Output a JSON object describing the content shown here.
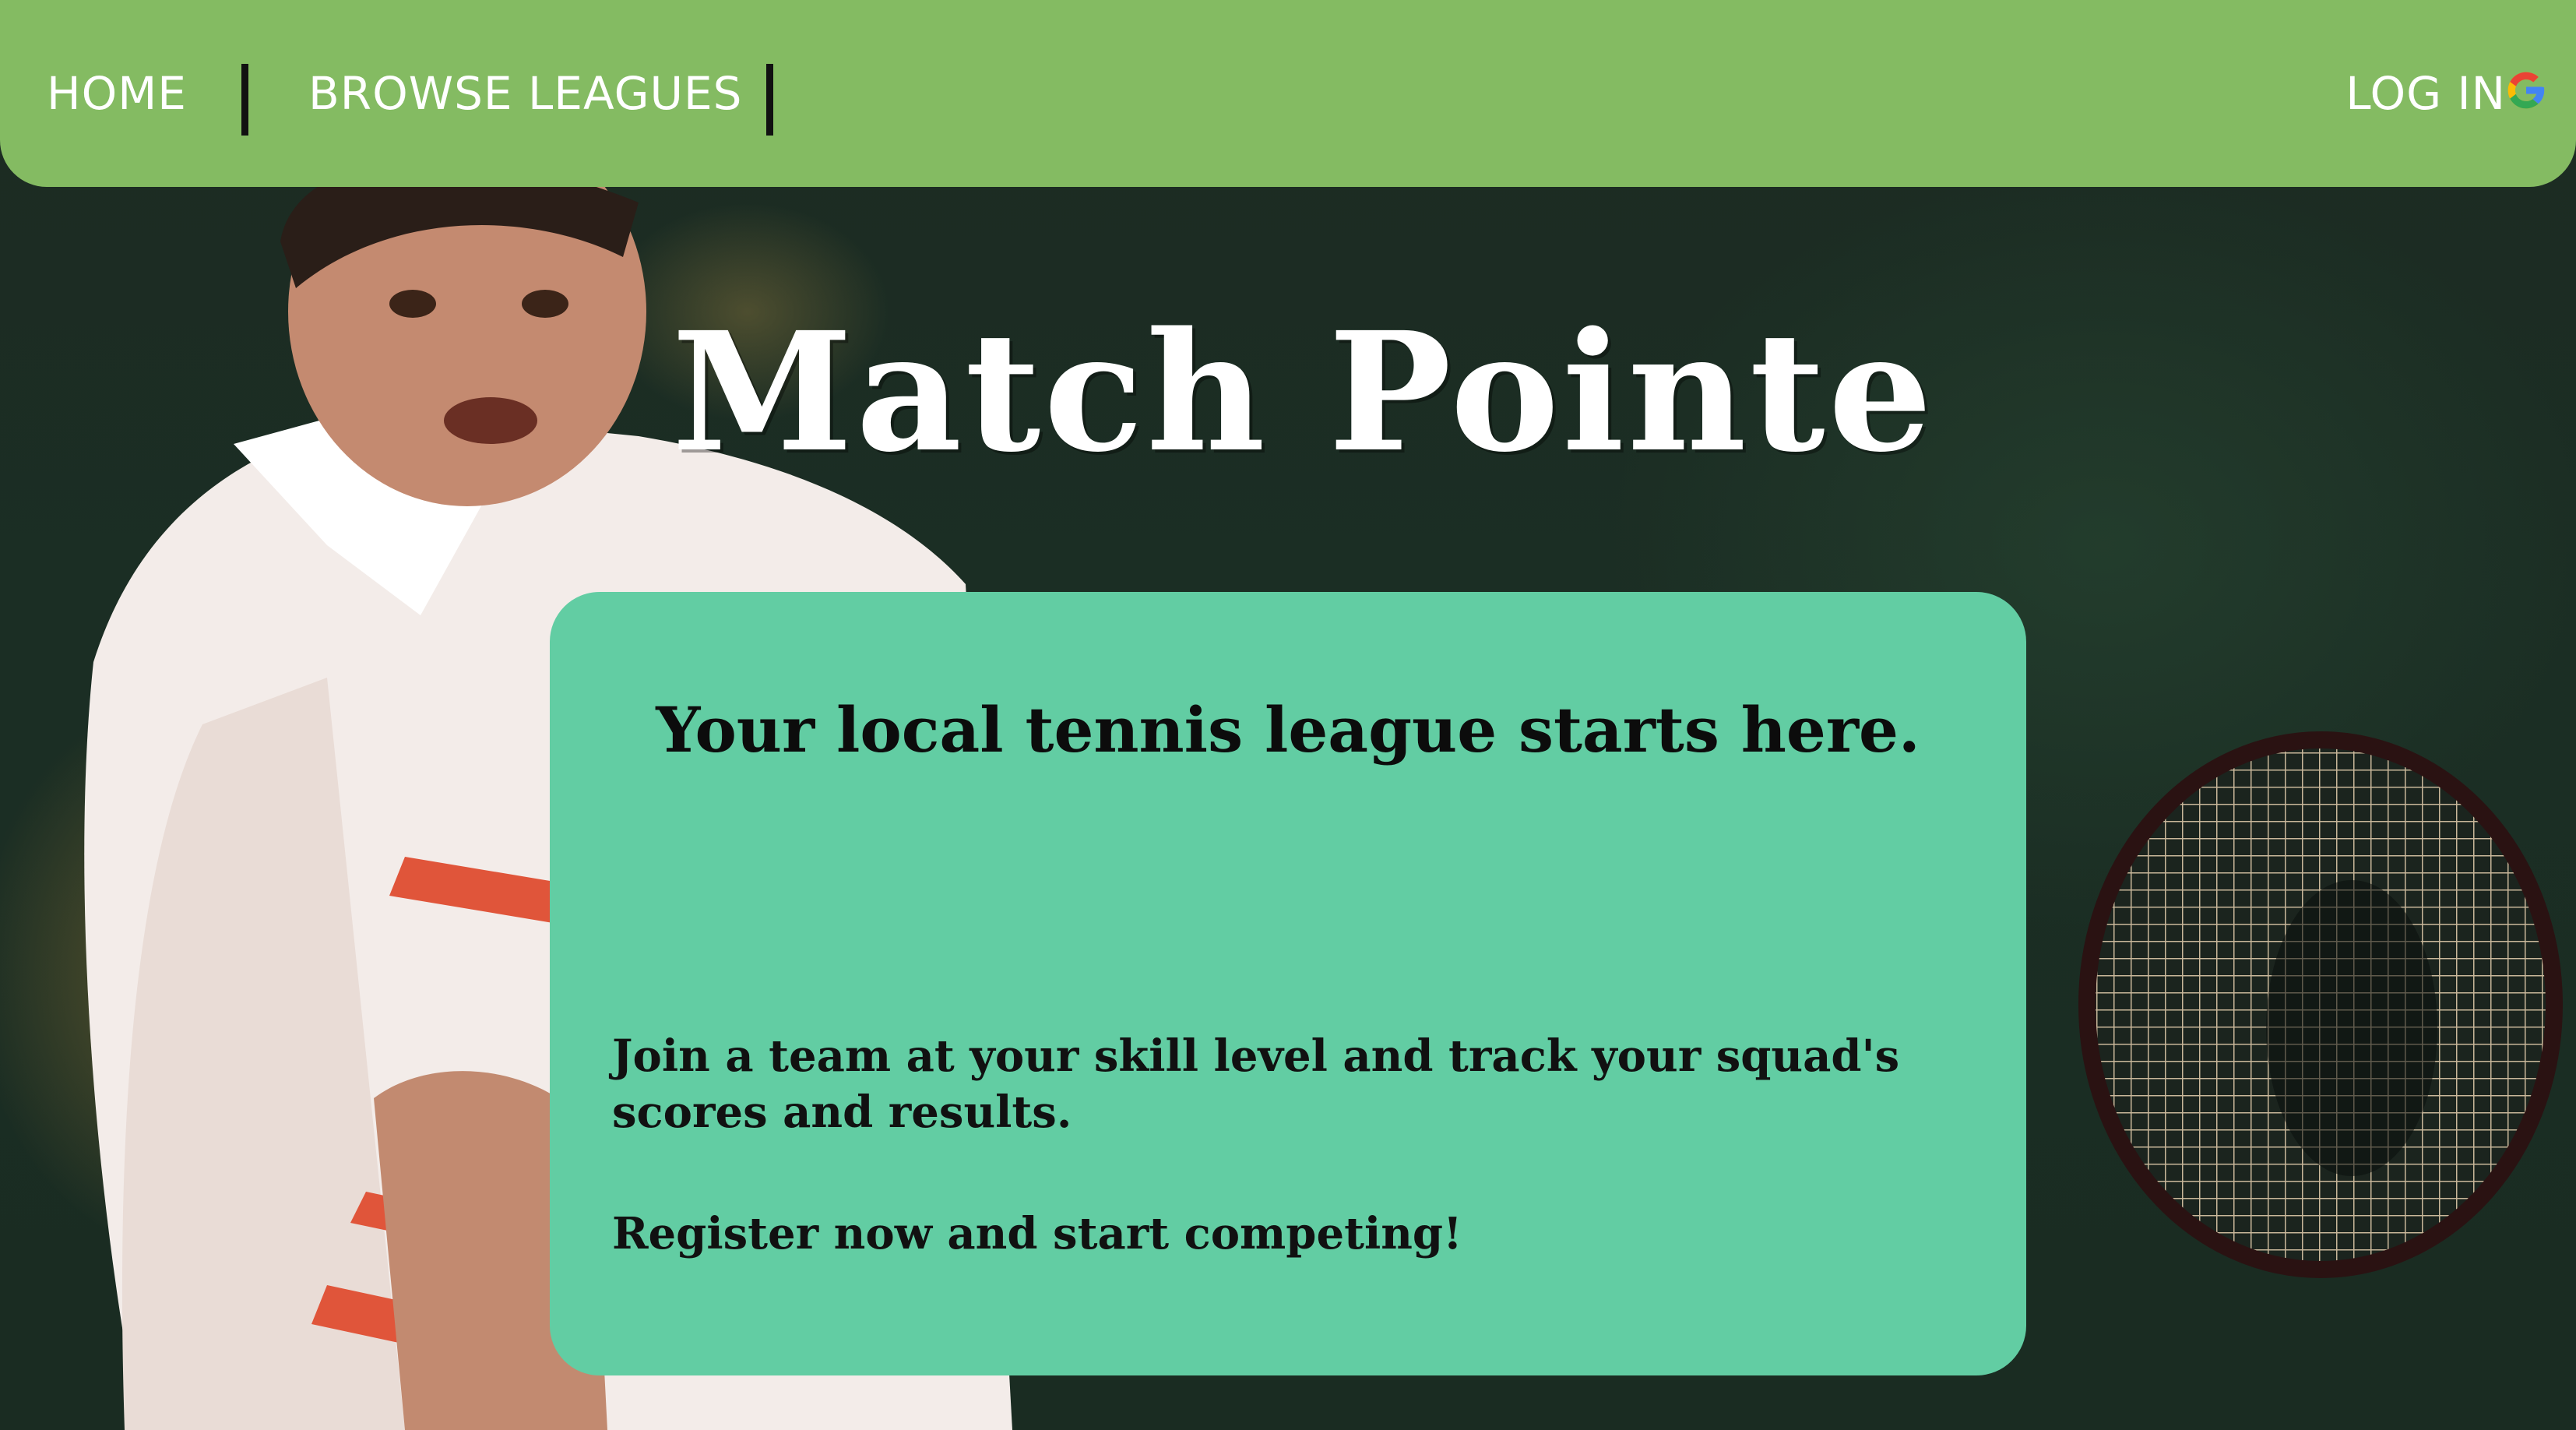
{
  "nav": {
    "home_label": "HOME",
    "browse_label": "BROWSE LEAGUES",
    "login_label": "LOG IN",
    "login_icon": "google-icon"
  },
  "hero": {
    "title": "Match Pointe"
  },
  "card": {
    "headline": "Your local tennis league starts here.",
    "body_paragraph_1": "Join a team at your skill level and track your squad's scores and results.",
    "body_paragraph_2": "Register now and start competing!"
  },
  "colors": {
    "navbar": "#84bb62",
    "card": "#62cda3",
    "background": "#1a2a20"
  }
}
